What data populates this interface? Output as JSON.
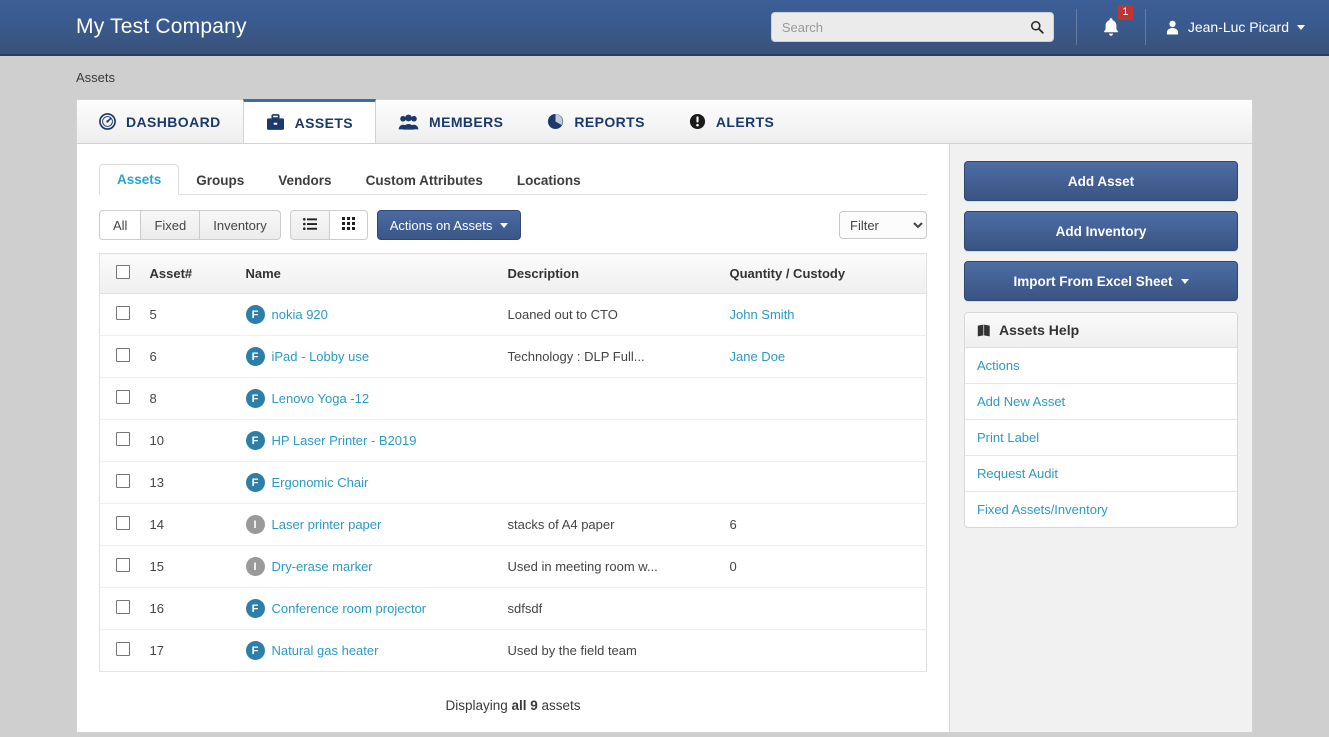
{
  "header": {
    "brand": "My Test Company",
    "search_placeholder": "Search",
    "search_value": "",
    "notification_count": "1",
    "user_name": "Jean-Luc Picard"
  },
  "breadcrumb": "Assets",
  "main_tabs": [
    {
      "label": "DASHBOARD",
      "icon": "gauge-icon",
      "active": false
    },
    {
      "label": "ASSETS",
      "icon": "briefcase-icon",
      "active": true
    },
    {
      "label": "MEMBERS",
      "icon": "people-icon",
      "active": false
    },
    {
      "label": "REPORTS",
      "icon": "pie-chart-icon",
      "active": false
    },
    {
      "label": "ALERTS",
      "icon": "exclamation-circle-icon",
      "active": false
    }
  ],
  "sub_tabs": [
    {
      "label": "Assets",
      "active": true
    },
    {
      "label": "Groups",
      "active": false
    },
    {
      "label": "Vendors",
      "active": false
    },
    {
      "label": "Custom Attributes",
      "active": false
    },
    {
      "label": "Locations",
      "active": false
    }
  ],
  "toolbar": {
    "segments": [
      {
        "label": "All",
        "active": true
      },
      {
        "label": "Fixed",
        "active": false
      },
      {
        "label": "Inventory",
        "active": false
      }
    ],
    "view_list_icon": "list-view-icon",
    "view_grid_icon": "grid-view-icon",
    "actions_label": "Actions on Assets",
    "filter_value": "Filter"
  },
  "table": {
    "columns": [
      "",
      "Asset#",
      "Name",
      "Description",
      "Quantity / Custody"
    ],
    "rows": [
      {
        "num": "5",
        "type": "F",
        "name": "nokia 920",
        "desc": "Loaned out to CTO",
        "qty": "John Smith",
        "qty_link": true
      },
      {
        "num": "6",
        "type": "F",
        "name": "iPad - Lobby use",
        "desc": "Technology : DLP Full...",
        "qty": "Jane Doe",
        "qty_link": true
      },
      {
        "num": "8",
        "type": "F",
        "name": "Lenovo Yoga -12",
        "desc": "",
        "qty": "",
        "qty_link": false
      },
      {
        "num": "10",
        "type": "F",
        "name": "HP Laser Printer - B2019",
        "desc": "",
        "qty": "",
        "qty_link": false
      },
      {
        "num": "13",
        "type": "F",
        "name": "Ergonomic Chair",
        "desc": "",
        "qty": "",
        "qty_link": false
      },
      {
        "num": "14",
        "type": "I",
        "name": "Laser printer paper",
        "desc": "stacks of A4 paper",
        "qty": "6",
        "qty_link": false
      },
      {
        "num": "15",
        "type": "I",
        "name": "Dry-erase marker",
        "desc": "Used in meeting room w...",
        "qty": "0",
        "qty_link": false
      },
      {
        "num": "16",
        "type": "F",
        "name": "Conference room projector",
        "desc": "sdfsdf",
        "qty": "",
        "qty_link": false
      },
      {
        "num": "17",
        "type": "F",
        "name": "Natural gas heater",
        "desc": "Used by the field team",
        "qty": "",
        "qty_link": false
      }
    ],
    "footer_prefix": "Displaying ",
    "footer_strong": "all 9",
    "footer_suffix": " assets"
  },
  "sidebar": {
    "buttons": [
      {
        "label": "Add Asset",
        "has_caret": false
      },
      {
        "label": "Add Inventory",
        "has_caret": false
      },
      {
        "label": "Import From Excel Sheet",
        "has_caret": true
      }
    ],
    "help_title": "Assets Help",
    "help_items": [
      "Actions",
      "Add New Asset",
      "Print Label",
      "Request Audit",
      "Fixed Assets/Inventory"
    ]
  },
  "colors": {
    "header_top": "#3c5f97",
    "header_bottom": "#3a5179",
    "accent_link": "#2b9ac4",
    "badge_red": "#bf3434",
    "badge_fixed": "#2e7fa8",
    "badge_inventory": "#9a9a9a",
    "button_primary": "#3b5687",
    "tab_text": "#1b3a6b"
  }
}
